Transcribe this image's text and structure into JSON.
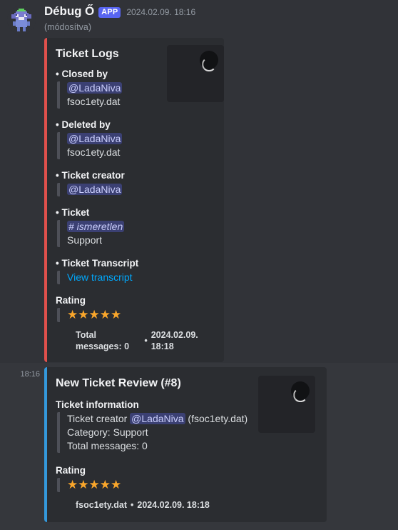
{
  "theme": {
    "page_bg": "#313338",
    "embed_bg": "#2b2d31",
    "hover_bg": "#35373c",
    "accent_app_badge": "#5865f2",
    "embed1_border": "#e0504c",
    "embed2_border": "#3498db",
    "star_color": "#f9a62b",
    "link_color": "#00a8fc",
    "mention_text": "#c9cdfb"
  },
  "message": {
    "author": "Débug Ő",
    "app_badge": "APP",
    "timestamp": "2024.02.09. 18:16",
    "edited_label": "(módosítva)",
    "avatar_icon": "bot-avatar"
  },
  "embed1": {
    "title": "Ticket Logs",
    "thumbnail_icon": "image-loading-spinner",
    "fields": [
      {
        "name": "Closed by",
        "bullet": "•",
        "lines": [
          {
            "type": "mention",
            "text": "@LadaNiva"
          },
          {
            "type": "text",
            "text": "fsoc1ety.dat"
          }
        ]
      },
      {
        "name": "Deleted by",
        "bullet": "•",
        "lines": [
          {
            "type": "mention",
            "text": "@LadaNiva"
          },
          {
            "type": "text",
            "text": "fsoc1ety.dat"
          }
        ]
      },
      {
        "name": "Ticket creator",
        "bullet": "•",
        "lines": [
          {
            "type": "mention",
            "text": "@LadaNiva"
          }
        ]
      },
      {
        "name": "Ticket",
        "bullet": "•",
        "lines": [
          {
            "type": "channel",
            "text": "# ismeretlen"
          },
          {
            "type": "text",
            "text": "Support"
          }
        ]
      },
      {
        "name": "Ticket Transcript",
        "bullet": "•",
        "lines": [
          {
            "type": "link",
            "text": "View transcript"
          }
        ]
      },
      {
        "name": "Rating",
        "bullet": "",
        "lines": [
          {
            "type": "stars",
            "text": "★★★★★"
          }
        ]
      }
    ],
    "footer_text": "Total messages: 0",
    "footer_sep": "•",
    "footer_timestamp": "2024.02.09. 18:18"
  },
  "embed2": {
    "gutter_time": "18:16",
    "title": "New Ticket Review (#8)",
    "thumbnail_icon": "image-loading-spinner",
    "fields": [
      {
        "name": "Ticket information",
        "bullet": "",
        "lines": [
          {
            "type": "creator",
            "prefix": "Ticket creator ",
            "mention": "@LadaNiva",
            "suffix": " (fsoc1ety.dat)"
          },
          {
            "type": "text",
            "text": "Category: Support"
          },
          {
            "type": "text",
            "text": "Total messages: 0"
          }
        ]
      },
      {
        "name": "Rating",
        "bullet": "",
        "lines": [
          {
            "type": "stars",
            "text": "★★★★★"
          }
        ]
      }
    ],
    "footer_text": "fsoc1ety.dat",
    "footer_sep": "•",
    "footer_timestamp": "2024.02.09. 18:18"
  }
}
